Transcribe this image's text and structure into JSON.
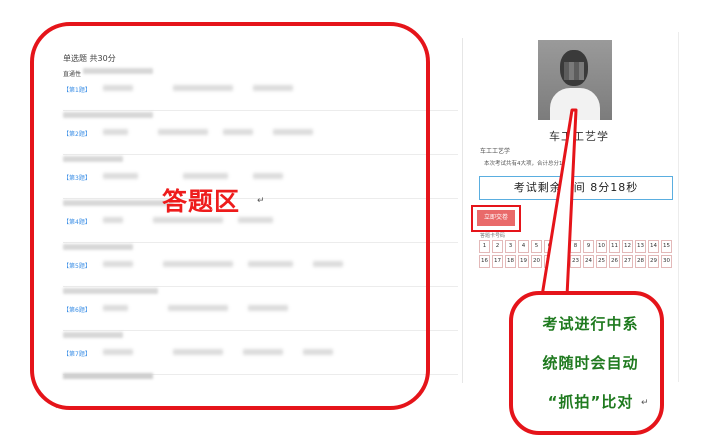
{
  "answer_area": {
    "section_title": "单选题 共30分",
    "first_stem_prefix": "直通性",
    "questions": [
      {
        "tag": "【第1题】"
      },
      {
        "tag": "【第2题】"
      },
      {
        "tag": "【第3题】"
      },
      {
        "tag": "【第4题】"
      },
      {
        "tag": "【第5题】"
      },
      {
        "tag": "【第6题】"
      },
      {
        "tag": "【第7题】"
      }
    ]
  },
  "info_panel": {
    "course_title": "车工工艺学",
    "course_subtitle": "车工工艺学",
    "exam_info": "本次考试共有4大项，合计总分10…",
    "timer": "考试剩余时间 8分18秒",
    "submit_label": "立即交卷",
    "answer_card_label": "答题卡号码",
    "question_numbers": [
      1,
      2,
      3,
      4,
      5,
      6,
      7,
      8,
      9,
      10,
      11,
      12,
      13,
      14,
      15,
      16,
      17,
      18,
      19,
      20,
      21,
      22,
      23,
      24,
      25,
      26,
      27,
      28,
      29,
      30
    ]
  },
  "annotations": {
    "answer_zone_label": "答题区",
    "callout_lines": [
      "考试进行中系",
      "统随时会自动",
      "“抓拍”比对"
    ],
    "accent_color": "#e5141a",
    "callout_text_color": "#1f7a1f"
  }
}
